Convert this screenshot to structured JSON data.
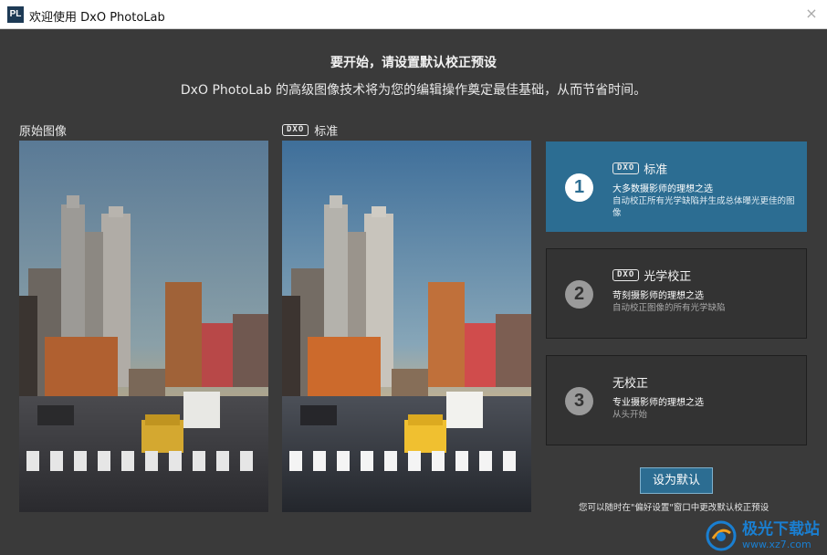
{
  "window": {
    "app_icon_text": "PL",
    "title": "欢迎使用 DxO PhotoLab",
    "close_glyph": "×"
  },
  "intro": {
    "heading": "要开始，请设置默认校正预设",
    "subheading": "DxO PhotoLab 的高级图像技术将为您的编辑操作奠定最佳基础，从而节省时间。"
  },
  "images": {
    "original_label": "原始图像",
    "standard_badge": "DXO",
    "standard_label": "标准"
  },
  "presets": [
    {
      "number": "1",
      "badge": "DXO",
      "title": "标准",
      "description": "大多数摄影师的理想之选",
      "detail": "自动校正所有光学缺陷并生成总体曝光更佳的图像",
      "selected": true
    },
    {
      "number": "2",
      "badge": "DXO",
      "title": "光学校正",
      "description": "苛刻摄影师的理想之选",
      "detail": "自动校正图像的所有光学缺陷",
      "selected": false
    },
    {
      "number": "3",
      "badge": "",
      "title": "无校正",
      "description": "专业摄影师的理想之选",
      "detail": "从头开始",
      "selected": false
    }
  ],
  "actions": {
    "set_default_label": "设为默认",
    "hint": "您可以随时在\"偏好设置\"窗口中更改默认校正预设"
  },
  "watermark": {
    "name": "极光下载站",
    "url": "www.xz7.com"
  },
  "colors": {
    "background": "#3a3a3a",
    "accent": "#2c6d92",
    "card": "#333333"
  }
}
